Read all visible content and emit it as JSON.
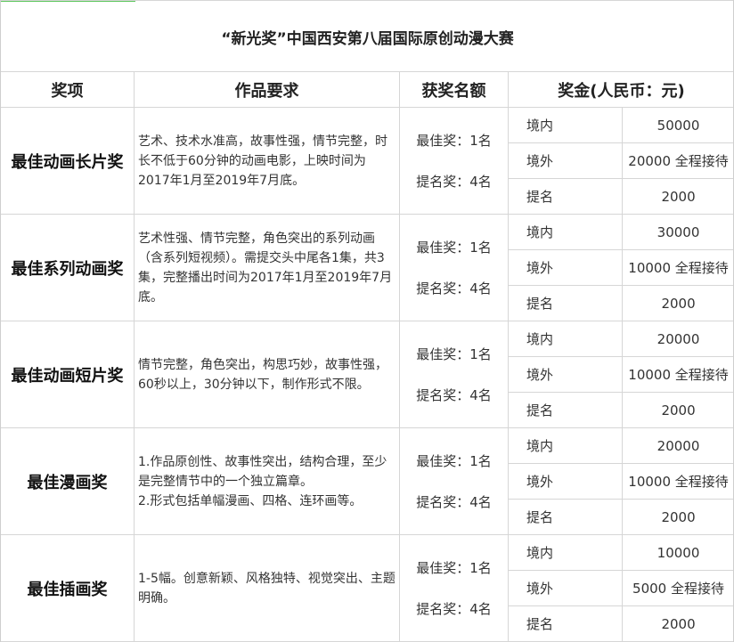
{
  "title": "“新光奖”中国西安第八届国际原创动漫大赛",
  "headers": [
    "奖项",
    "作品要求",
    "获奖名额",
    "奖金(人民币：元)"
  ],
  "rows": [
    {
      "award": "最佳动画长片奖",
      "requirement": "艺术、技术水准高，故事性强，情节完整，时长不低于60分钟的动画电影，上映时间为2017年1月至2019年7月底。",
      "quota": [
        "最佳奖：1名",
        "提名奖：4名"
      ],
      "prizes": [
        {
          "label": "境内",
          "amount": "50000"
        },
        {
          "label": "境外",
          "amount": "20000 全程接待"
        },
        {
          "label": "提名",
          "amount": "2000"
        }
      ]
    },
    {
      "award": "最佳系列动画奖",
      "requirement": "艺术性强、情节完整，角色突出的系列动画（含系列短视频）。需提交头中尾各1集，共3集，完整播出时间为2017年1月至2019年7月底。",
      "quota": [
        "最佳奖：1名",
        "提名奖：4名"
      ],
      "prizes": [
        {
          "label": "境内",
          "amount": "30000"
        },
        {
          "label": "境外",
          "amount": "10000 全程接待"
        },
        {
          "label": "提名",
          "amount": "2000"
        }
      ]
    },
    {
      "award": "最佳动画短片奖",
      "requirement": "情节完整，角色突出，构思巧妙，故事性强，60秒以上，30分钟以下，制作形式不限。",
      "quota": [
        "最佳奖：1名",
        "提名奖：4名"
      ],
      "prizes": [
        {
          "label": "境内",
          "amount": "20000"
        },
        {
          "label": "境外",
          "amount": "10000 全程接待"
        },
        {
          "label": "提名",
          "amount": "2000"
        }
      ]
    },
    {
      "award": "最佳漫画奖",
      "requirement": "1.作品原创性、故事性突出，结构合理，至少是完整情节中的一个独立篇章。\n2.形式包括单幅漫画、四格、连环画等。",
      "quota": [
        "最佳奖：1名",
        "提名奖：4名"
      ],
      "prizes": [
        {
          "label": "境内",
          "amount": "20000"
        },
        {
          "label": "境外",
          "amount": "10000 全程接待"
        },
        {
          "label": "提名",
          "amount": "2000"
        }
      ]
    },
    {
      "award": "最佳插画奖",
      "requirement": "1-5幅。创意新颖、风格独特、视觉突出、主题明确。",
      "quota": [
        "最佳奖：1名",
        "提名奖：4名"
      ],
      "prizes": [
        {
          "label": "境内",
          "amount": "10000"
        },
        {
          "label": "境外",
          "amount": "5000 全程接待"
        },
        {
          "label": "提名",
          "amount": "2000"
        }
      ]
    }
  ]
}
